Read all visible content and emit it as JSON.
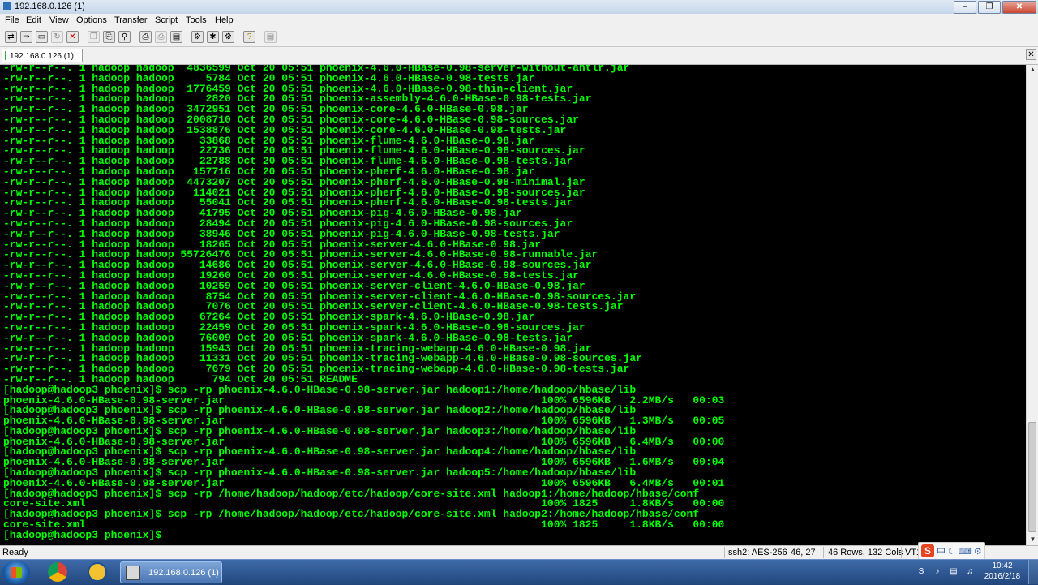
{
  "window": {
    "title": "192.168.0.126 (1)"
  },
  "menu": [
    "File",
    "Edit",
    "View",
    "Options",
    "Transfer",
    "Script",
    "Tools",
    "Help"
  ],
  "toolbar_icons": [
    "connect-icon",
    "quick-connect-icon",
    "connect-in-tab-icon",
    "reconnect-icon",
    "disconnect-icon",
    "copy-icon",
    "paste-icon",
    "find-icon",
    "print-icon",
    "print-setup-icon",
    "print-screen-icon",
    "session-options-icon",
    "global-options-icon",
    "keymap-icon",
    "help-icon",
    "sftp-icon"
  ],
  "tab": {
    "label": "192.168.0.126  (1)"
  },
  "terminal": {
    "lines": [
      "-rw-r--r--. 1 hadoop hadoop  4836599 Oct 20 05:51 phoenix-4.6.0-HBase-0.98-server-without-antlr.jar",
      "-rw-r--r--. 1 hadoop hadoop     5784 Oct 20 05:51 phoenix-4.6.0-HBase-0.98-tests.jar",
      "-rw-r--r--. 1 hadoop hadoop  1776459 Oct 20 05:51 phoenix-4.6.0-HBase-0.98-thin-client.jar",
      "-rw-r--r--. 1 hadoop hadoop     2820 Oct 20 05:51 phoenix-assembly-4.6.0-HBase-0.98-tests.jar",
      "-rw-r--r--. 1 hadoop hadoop  3472951 Oct 20 05:51 phoenix-core-4.6.0-HBase-0.98.jar",
      "-rw-r--r--. 1 hadoop hadoop  2008710 Oct 20 05:51 phoenix-core-4.6.0-HBase-0.98-sources.jar",
      "-rw-r--r--. 1 hadoop hadoop  1538876 Oct 20 05:51 phoenix-core-4.6.0-HBase-0.98-tests.jar",
      "-rw-r--r--. 1 hadoop hadoop    33868 Oct 20 05:51 phoenix-flume-4.6.0-HBase-0.98.jar",
      "-rw-r--r--. 1 hadoop hadoop    22736 Oct 20 05:51 phoenix-flume-4.6.0-HBase-0.98-sources.jar",
      "-rw-r--r--. 1 hadoop hadoop    22788 Oct 20 05:51 phoenix-flume-4.6.0-HBase-0.98-tests.jar",
      "-rw-r--r--. 1 hadoop hadoop   157716 Oct 20 05:51 phoenix-pherf-4.6.0-HBase-0.98.jar",
      "-rw-r--r--. 1 hadoop hadoop  4473207 Oct 20 05:51 phoenix-pherf-4.6.0-HBase-0.98-minimal.jar",
      "-rw-r--r--. 1 hadoop hadoop   114021 Oct 20 05:51 phoenix-pherf-4.6.0-HBase-0.98-sources.jar",
      "-rw-r--r--. 1 hadoop hadoop    55041 Oct 20 05:51 phoenix-pherf-4.6.0-HBase-0.98-tests.jar",
      "-rw-r--r--. 1 hadoop hadoop    41795 Oct 20 05:51 phoenix-pig-4.6.0-HBase-0.98.jar",
      "-rw-r--r--. 1 hadoop hadoop    28494 Oct 20 05:51 phoenix-pig-4.6.0-HBase-0.98-sources.jar",
      "-rw-r--r--. 1 hadoop hadoop    38946 Oct 20 05:51 phoenix-pig-4.6.0-HBase-0.98-tests.jar",
      "-rw-r--r--. 1 hadoop hadoop    18265 Oct 20 05:51 phoenix-server-4.6.0-HBase-0.98.jar",
      "-rw-r--r--. 1 hadoop hadoop 55726476 Oct 20 05:51 phoenix-server-4.6.0-HBase-0.98-runnable.jar",
      "-rw-r--r--. 1 hadoop hadoop    14686 Oct 20 05:51 phoenix-server-4.6.0-HBase-0.98-sources.jar",
      "-rw-r--r--. 1 hadoop hadoop    19260 Oct 20 05:51 phoenix-server-4.6.0-HBase-0.98-tests.jar",
      "-rw-r--r--. 1 hadoop hadoop    10259 Oct 20 05:51 phoenix-server-client-4.6.0-HBase-0.98.jar",
      "-rw-r--r--. 1 hadoop hadoop     8754 Oct 20 05:51 phoenix-server-client-4.6.0-HBase-0.98-sources.jar",
      "-rw-r--r--. 1 hadoop hadoop     7076 Oct 20 05:51 phoenix-server-client-4.6.0-HBase-0.98-tests.jar",
      "-rw-r--r--. 1 hadoop hadoop    67264 Oct 20 05:51 phoenix-spark-4.6.0-HBase-0.98.jar",
      "-rw-r--r--. 1 hadoop hadoop    22459 Oct 20 05:51 phoenix-spark-4.6.0-HBase-0.98-sources.jar",
      "-rw-r--r--. 1 hadoop hadoop    76009 Oct 20 05:51 phoenix-spark-4.6.0-HBase-0.98-tests.jar",
      "-rw-r--r--. 1 hadoop hadoop    15943 Oct 20 05:51 phoenix-tracing-webapp-4.6.0-HBase-0.98.jar",
      "-rw-r--r--. 1 hadoop hadoop    11331 Oct 20 05:51 phoenix-tracing-webapp-4.6.0-HBase-0.98-sources.jar",
      "-rw-r--r--. 1 hadoop hadoop     7679 Oct 20 05:51 phoenix-tracing-webapp-4.6.0-HBase-0.98-tests.jar",
      "-rw-r--r--. 1 hadoop hadoop      794 Oct 20 05:51 README",
      "[hadoop@hadoop3 phoenix]$ scp -rp phoenix-4.6.0-HBase-0.98-server.jar hadoop1:/home/hadoop/hbase/lib",
      "phoenix-4.6.0-HBase-0.98-server.jar                                                  100% 6596KB   2.2MB/s   00:03",
      "[hadoop@hadoop3 phoenix]$ scp -rp phoenix-4.6.0-HBase-0.98-server.jar hadoop2:/home/hadoop/hbase/lib",
      "phoenix-4.6.0-HBase-0.98-server.jar                                                  100% 6596KB   1.3MB/s   00:05",
      "[hadoop@hadoop3 phoenix]$ scp -rp phoenix-4.6.0-HBase-0.98-server.jar hadoop3:/home/hadoop/hbase/lib",
      "phoenix-4.6.0-HBase-0.98-server.jar                                                  100% 6596KB   6.4MB/s   00:00",
      "[hadoop@hadoop3 phoenix]$ scp -rp phoenix-4.6.0-HBase-0.98-server.jar hadoop4:/home/hadoop/hbase/lib",
      "phoenix-4.6.0-HBase-0.98-server.jar                                                  100% 6596KB   1.6MB/s   00:04",
      "[hadoop@hadoop3 phoenix]$ scp -rp phoenix-4.6.0-HBase-0.98-server.jar hadoop5:/home/hadoop/hbase/lib",
      "phoenix-4.6.0-HBase-0.98-server.jar                                                  100% 6596KB   6.4MB/s   00:01",
      "[hadoop@hadoop3 phoenix]$ scp -rp /home/hadoop/hadoop/etc/hadoop/core-site.xml hadoop1:/home/hadoop/hbase/conf",
      "core-site.xml                                                                        100% 1825     1.8KB/s   00:00",
      "[hadoop@hadoop3 phoenix]$ scp -rp /home/hadoop/hadoop/etc/hadoop/core-site.xml hadoop2:/home/hadoop/hbase/conf",
      "core-site.xml                                                                        100% 1825     1.8KB/s   00:00",
      "[hadoop@hadoop3 phoenix]$ "
    ]
  },
  "status": {
    "ready": "Ready",
    "cipher": "ssh2: AES-256",
    "cursor": "46,  27",
    "size": "46 Rows, 132 Cols",
    "term": "VT1"
  },
  "ime": {
    "mode": "中"
  },
  "taskbar": {
    "task_label": "192.168.0.126 (1)",
    "time": "10:42",
    "date": "2016/2/18"
  },
  "colors": {
    "terminal_bg": "#000000",
    "terminal_fg": "#00ff00"
  }
}
